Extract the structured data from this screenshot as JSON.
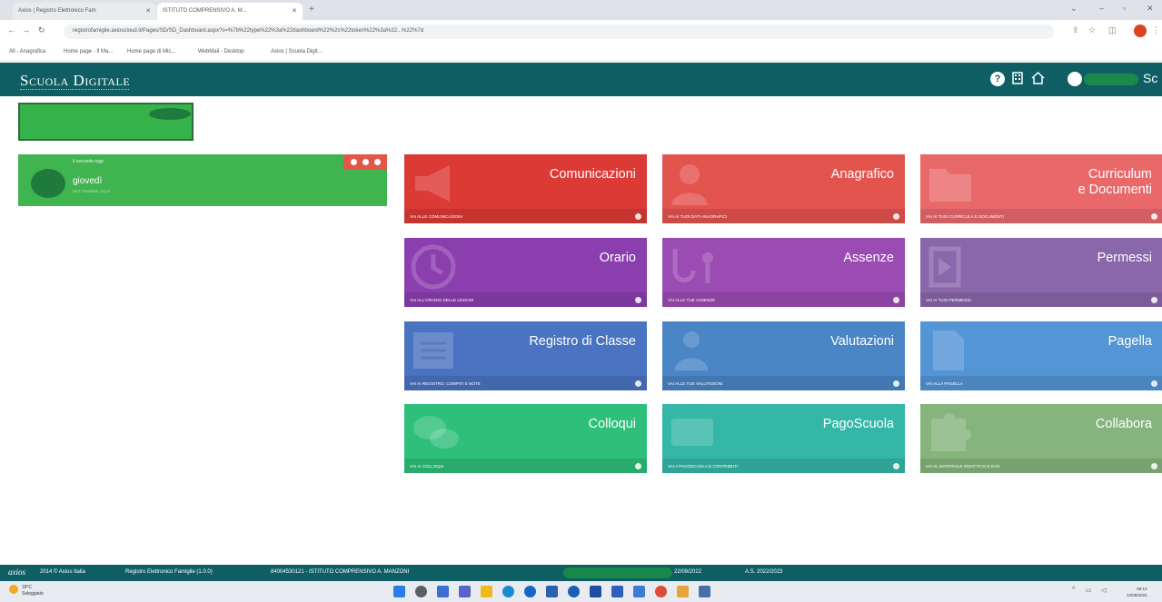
{
  "browser": {
    "tabs": [
      {
        "label": "Axios | Registro Elettronico Fam"
      },
      {
        "label": "ISTITUTO COMPRENSIVO A. M..."
      }
    ],
    "url": "registrofamiglie.axioscloud.it/Pages/SD/SD_Dashboard.aspx?s=%7b%22type%22%3a%22dashboard%22%2c%22token%22%3a%22...%22%7d",
    "bookmarks": [
      "All - Anagrafica",
      "Home page - Il Ma...",
      "Home page di Mic...",
      "WebMail - Desktop",
      "Axios | Scuola Digit..."
    ]
  },
  "header": {
    "brand": "Scuola Digitale",
    "user_initial": "Sc"
  },
  "date_widget": {
    "top_text": "Il secondo oggi",
    "day": "giovedì",
    "month": "SETTEMBRE 2022"
  },
  "tiles": [
    {
      "title": "Comunicazioni",
      "link": "VAI ALLE COMUNICAZIONI",
      "color": "#dc3a35"
    },
    {
      "title": "Anagrafico",
      "link": "VAI AI TUOI DATI ANAGRAFICI",
      "color": "#e4544f"
    },
    {
      "title": "Curriculum\ne Documenti",
      "link": "VAI AI TUOI CURRICULA E DOCUMENTI",
      "color": "#e9696b"
    },
    {
      "title": "Orario",
      "link": "VAI ALL'ORARIO DELLE LEZIONI",
      "color": "#8b3fae"
    },
    {
      "title": "Assenze",
      "link": "VAI ALLE TUE ASSENZE",
      "color": "#9b4cb3"
    },
    {
      "title": "Permessi",
      "link": "VAI AI TUOI PERMESSI",
      "color": "#8a67ab"
    },
    {
      "title": "Registro di Classe",
      "link": "VAI AI REGISTRO, COMPITI E NOTE",
      "color": "#4a73c1"
    },
    {
      "title": "Valutazioni",
      "link": "VAI ALLE TUE VALUTAZIONI",
      "color": "#4a86c6"
    },
    {
      "title": "Pagella",
      "link": "VAI ALLA PAGELLA",
      "color": "#5495d6"
    },
    {
      "title": "Colloqui",
      "link": "VAI AI COLLOQUI",
      "color": "#2ebf7a"
    },
    {
      "title": "PagoScuola",
      "link": "VAI A PAGOSCUOLA E CONTRIBUTI",
      "color": "#35b7a7"
    },
    {
      "title": "Collabora",
      "link": "VAI AL MATERIALE DIDATTICO E DAD",
      "color": "#86b47d"
    }
  ],
  "footer": {
    "logo": "axios",
    "copyright": "2014 © Axios Italia",
    "product": "Registro Elettronico Famiglie (1.0.0)",
    "school": "84004530121 - ISTITUTO COMPRENSIVO A. MANZONI",
    "date": "22/09/2022",
    "year": "A.S. 2022/2023"
  },
  "taskbar": {
    "weather_temp": "18°C",
    "weather_desc": "Soleggiato",
    "time": "09:13",
    "date": "22/09/2022"
  }
}
